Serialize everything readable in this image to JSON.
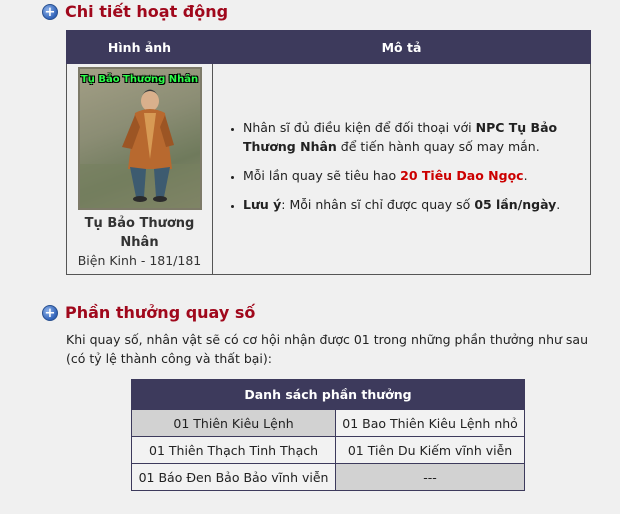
{
  "section1": {
    "title": "Chi tiết hoạt động"
  },
  "activity_table": {
    "headers": [
      "Hình ảnh",
      "Mô tả"
    ],
    "npc": {
      "overlay_name": "Tụ Bảo Thương Nhân",
      "caption_line1": "Tụ Bảo Thương",
      "caption_line2": "Nhân",
      "location": "Biện Kinh - 181/181"
    },
    "items": [
      {
        "p1": "Nhân sĩ đủ điều kiện để đối thoại với ",
        "b1": "NPC Tụ Bảo",
        "b2": "Thương Nhân",
        "p2": " để tiến hành quay số may mắn."
      },
      {
        "p1": "Mỗi lần quay sẽ tiêu hao ",
        "red": "20 Tiêu Dao Ngọc",
        "p2": "."
      },
      {
        "b1": "Lưu ý",
        "p1": ": Mỗi nhân sĩ chỉ được quay số ",
        "b2": "05 lần/ngày",
        "p2": "."
      }
    ]
  },
  "section2": {
    "title": "Phần thưởng quay số",
    "intro": "Khi quay số, nhân vật sẽ có cơ hội nhận được 01 trong những phần thưởng như sau (có tỷ lệ thành công và thất bại):"
  },
  "rewards_table": {
    "header": "Danh sách phần thưởng",
    "rows": [
      [
        "01 Thiên Kiêu Lệnh",
        "01 Bao Thiên Kiêu Lệnh nhỏ"
      ],
      [
        "01 Thiên Thạch Tinh Thạch",
        "01 Tiên Du Kiếm vĩnh viễn"
      ],
      [
        "01 Báo Đen Bảo Bảo vĩnh viễn",
        "---"
      ]
    ]
  },
  "icons": {
    "section_bullet": "plus-circle-icon"
  },
  "colors": {
    "accent_red": "#a0081c",
    "header_bg": "#3d3a5c",
    "highlight_red": "#cc0000"
  }
}
